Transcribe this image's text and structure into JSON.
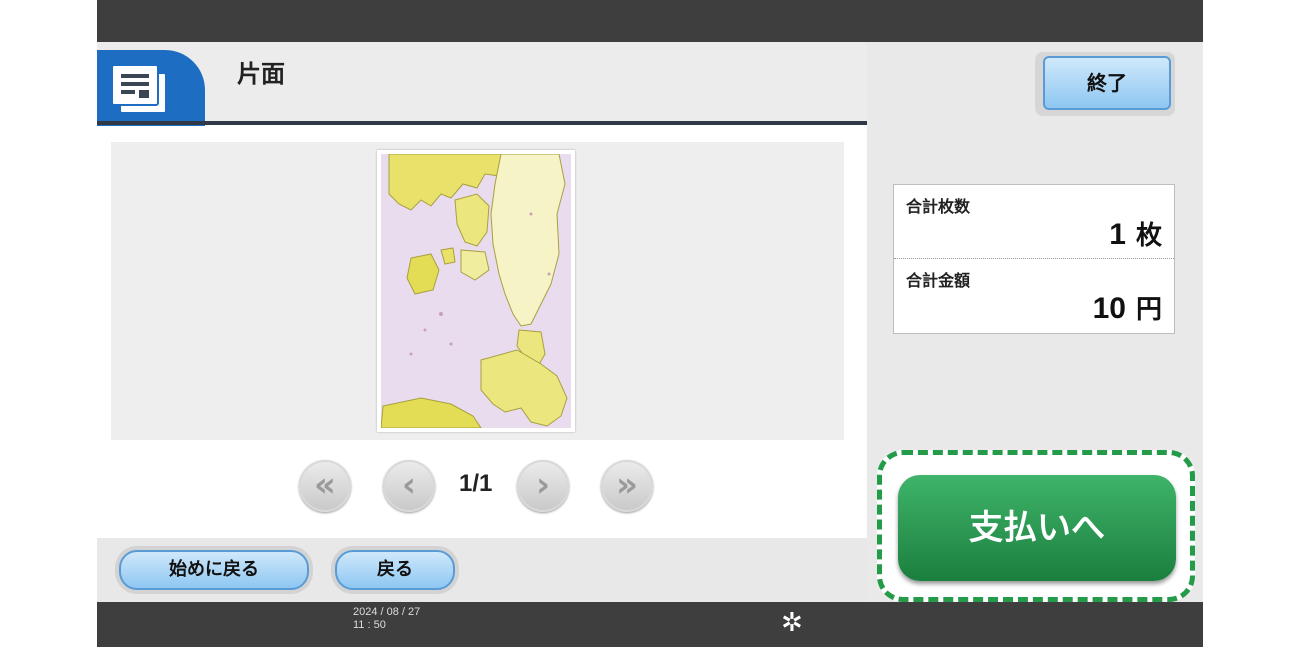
{
  "header": {
    "title": "片面",
    "icon": "document-stack-icon"
  },
  "preview": {
    "page_indicator": "1/1",
    "nav": {
      "first_icon": "double-chevron-left-icon",
      "prev_icon": "chevron-left-icon",
      "next_icon": "chevron-right-icon",
      "last_icon": "double-chevron-right-icon"
    }
  },
  "buttons": {
    "restart_label": "始めに戻る",
    "back_label": "戻る",
    "end_label": "終了",
    "pay_label": "支払いへ"
  },
  "summary": {
    "sheets_label": "合計枚数",
    "sheets_value": "1",
    "sheets_unit": "枚",
    "amount_label": "合計金額",
    "amount_value": "10",
    "amount_unit": "円"
  },
  "status": {
    "date": "2024 / 08 / 27",
    "time": "11 : 50",
    "settings_icon": "gear-icon"
  },
  "colors": {
    "accent_blue": "#1d6dc2",
    "pay_green": "#239b48",
    "bar_dark": "#3e3e3e"
  }
}
